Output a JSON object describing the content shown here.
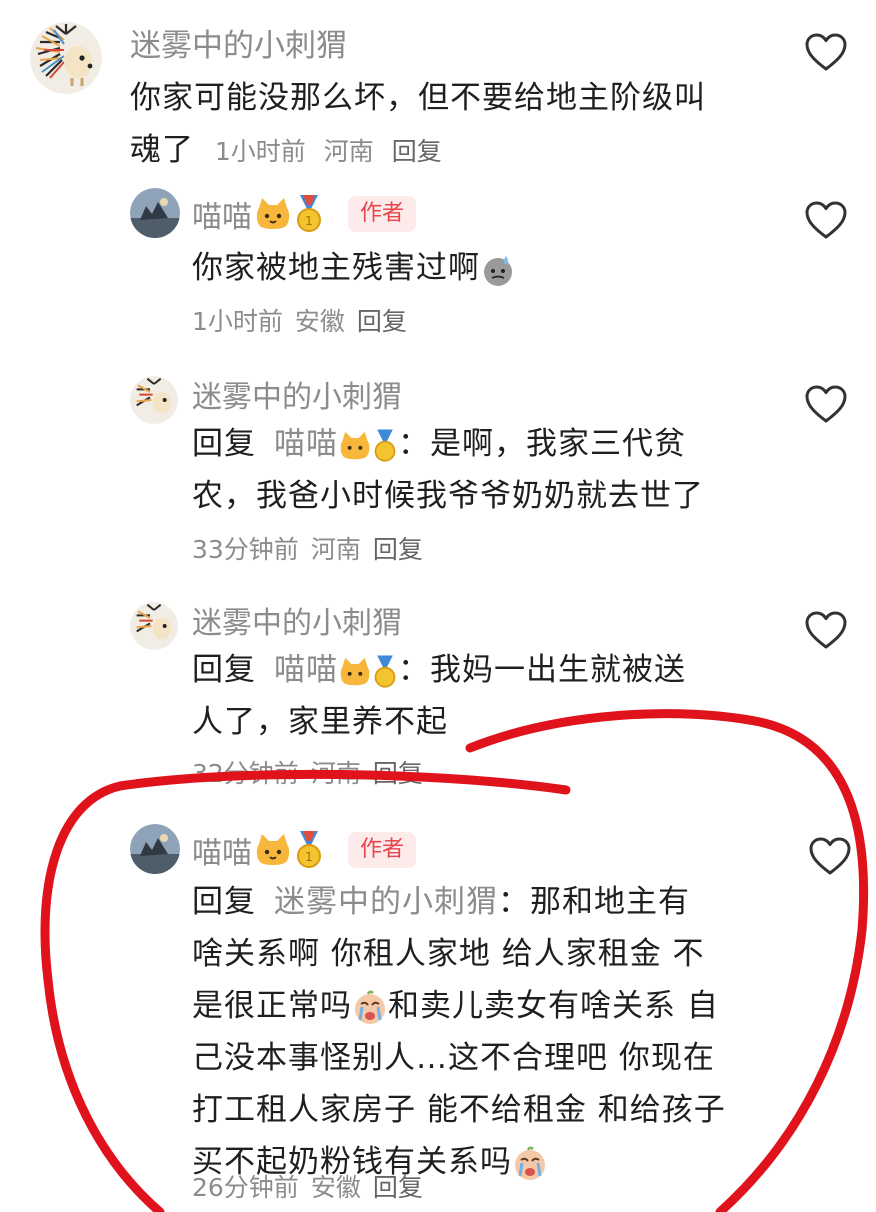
{
  "comments": [
    {
      "name": "迷雾中的小刺猬",
      "text_lines": [
        "你家可能没那么坏，但不要给地主阶级叫",
        "魂了"
      ],
      "time": "1小时前",
      "location": "河南",
      "reply_label": "回复"
    },
    {
      "name": "喵喵",
      "author_tag": "作者",
      "text": "你家被地主残害过啊",
      "time": "1小时前",
      "location": "安徽",
      "reply_label": "回复"
    },
    {
      "name": "迷雾中的小刺猬",
      "reply_prefix": "回复",
      "reply_target": "喵喵",
      "text_first": "：是啊，我家三代贫",
      "text_second": "农，我爸小时候我爷爷奶奶就去世了",
      "time": "33分钟前",
      "location": "河南",
      "reply_label": "回复"
    },
    {
      "name": "迷雾中的小刺猬",
      "reply_prefix": "回复",
      "reply_target": "喵喵",
      "text_first": "：我妈一出生就被送",
      "text_second": "人了，家里养不起",
      "time": "32分钟前",
      "location": "河南",
      "reply_label": "回复"
    },
    {
      "name": "喵喵",
      "author_tag": "作者",
      "reply_prefix": "回复",
      "reply_target": "迷雾中的小刺猬",
      "text_first": "：那和地主有",
      "text_lines": [
        "啥关系啊 你租人家地 给人家租金 不",
        "是很正常吗",
        "和卖儿卖女有啥关系 自",
        "己没本事怪别人…这不合理吧 你现在",
        "打工租人家房子 能不给租金 和给孩子",
        "买不起奶粉钱有关系吗"
      ],
      "time": "26分钟前",
      "location": "安徽",
      "reply_label": "回复"
    }
  ],
  "icons": {
    "like": "heart-outline-icon",
    "cat": "cat-face-emoji",
    "medal": "gold-medal-emoji",
    "sweat": "sweat-emoji",
    "crying": "crying-face-emoji"
  },
  "colors": {
    "accent_red": "#e8454b",
    "annotation_red": "#e0121b",
    "meta_gray": "#8c8c8c"
  }
}
